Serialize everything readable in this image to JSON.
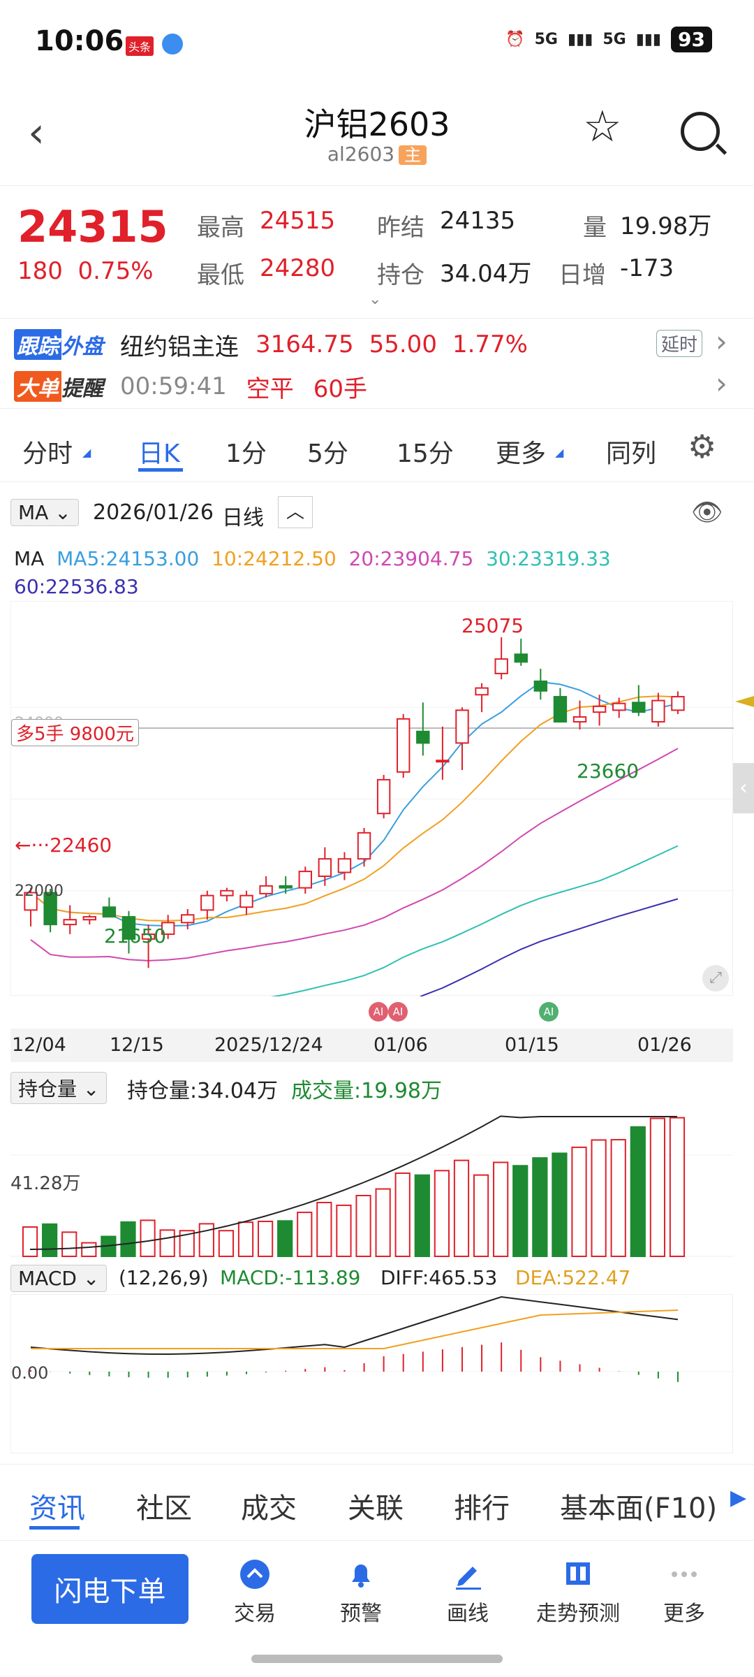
{
  "status": {
    "time": "10:06",
    "badge": "头条",
    "net1": "5G",
    "net2": "5G",
    "battery": "93"
  },
  "header": {
    "title": "沪铝2603",
    "code": "al2603",
    "main_tag": "主"
  },
  "quote": {
    "price": "24315",
    "change": "180",
    "change_pct": "0.75%",
    "high_label": "最高",
    "high": "24515",
    "low_label": "最低",
    "low": "24280",
    "settle_label": "昨结",
    "settle": "24135",
    "oi_label": "持仓",
    "oi": "34.04万",
    "vol_label": "量",
    "vol": "19.98万",
    "dayinc_label": "日增",
    "dayinc": "-173"
  },
  "ext": {
    "track_tag1": "跟踪",
    "track_tag2": "外盘",
    "track_name": "纽约铝主连",
    "track_price": "3164.75",
    "track_chg": "55.00",
    "track_pct": "1.77%",
    "delay": "延时",
    "big_tag1": "大单",
    "big_tag2": "提醒",
    "big_time": "00:59:41",
    "big_action": "空平",
    "big_qty": "60手"
  },
  "tabs": [
    {
      "label": "分时"
    },
    {
      "label": "日K"
    },
    {
      "label": "1分"
    },
    {
      "label": "5分"
    },
    {
      "label": "15分"
    },
    {
      "label": "更多"
    },
    {
      "label": "同列"
    }
  ],
  "chart_bar": {
    "indicator": "MA",
    "date": "2026/01/26",
    "period": "日线"
  },
  "ma": {
    "label": "MA",
    "ma5": "MA5:24153.00",
    "ma10": "10:24212.50",
    "ma20": "20:23904.75",
    "ma30": "30:23319.33",
    "ma60": "60:22536.83"
  },
  "main_chart": {
    "high_label": "25075",
    "low_label1": "21650",
    "low_label2": "23660",
    "left_label": "22460",
    "axis_top": "24000",
    "axis_bottom": "22000",
    "position_note": "多5手 9800元"
  },
  "dates": [
    "12/04",
    "12/15",
    "2025/12/24",
    "01/06",
    "01/15",
    "01/26"
  ],
  "ai_badges": [
    "AI",
    "AI",
    "AI"
  ],
  "oi_panel": {
    "selector": "持仓量",
    "oi": "持仓量:34.04万",
    "vol": "成交量:19.98万",
    "axis": "41.28万"
  },
  "macd_panel": {
    "selector": "MACD",
    "params": "(12,26,9)",
    "macd": "MACD:-113.89",
    "diff": "DIFF:465.53",
    "dea": "DEA:522.47",
    "axis": "0.00"
  },
  "subnav": [
    {
      "label": "资讯"
    },
    {
      "label": "社区"
    },
    {
      "label": "成交"
    },
    {
      "label": "关联"
    },
    {
      "label": "排行"
    },
    {
      "label": "基本面(F10)"
    }
  ],
  "bottom": {
    "flash": "闪电下单",
    "items": [
      {
        "label": "交易"
      },
      {
        "label": "预警"
      },
      {
        "label": "画线"
      },
      {
        "label": "走势预测"
      },
      {
        "label": "更多"
      }
    ]
  },
  "colors": {
    "up": "#e0202a",
    "down": "#1e8a32",
    "accent": "#2b6be6",
    "ma5": "#3a9ee0",
    "ma10": "#f0a020",
    "ma20": "#d048b0",
    "ma30": "#30c0b0",
    "ma60": "#3a30b0"
  },
  "chart_data": {
    "type": "candlestick",
    "candles": [
      {
        "o": 22250,
        "h": 22480,
        "l": 22080,
        "c": 22430
      },
      {
        "o": 22430,
        "h": 22470,
        "l": 22020,
        "c": 22100
      },
      {
        "o": 22100,
        "h": 22300,
        "l": 22000,
        "c": 22150
      },
      {
        "o": 22150,
        "h": 22200,
        "l": 22100,
        "c": 22180
      },
      {
        "o": 22280,
        "h": 22380,
        "l": 22180,
        "c": 22180
      },
      {
        "o": 22180,
        "h": 22240,
        "l": 21800,
        "c": 21950
      },
      {
        "o": 21950,
        "h": 22100,
        "l": 21650,
        "c": 22000
      },
      {
        "o": 22000,
        "h": 22200,
        "l": 21950,
        "c": 22120
      },
      {
        "o": 22120,
        "h": 22260,
        "l": 22050,
        "c": 22200
      },
      {
        "o": 22250,
        "h": 22450,
        "l": 22150,
        "c": 22400
      },
      {
        "o": 22400,
        "h": 22480,
        "l": 22340,
        "c": 22450
      },
      {
        "o": 22280,
        "h": 22450,
        "l": 22200,
        "c": 22400
      },
      {
        "o": 22420,
        "h": 22600,
        "l": 22380,
        "c": 22500
      },
      {
        "o": 22500,
        "h": 22600,
        "l": 22420,
        "c": 22480
      },
      {
        "o": 22480,
        "h": 22700,
        "l": 22420,
        "c": 22650
      },
      {
        "o": 22600,
        "h": 22900,
        "l": 22500,
        "c": 22780
      },
      {
        "o": 22640,
        "h": 22850,
        "l": 22560,
        "c": 22780
      },
      {
        "o": 22780,
        "h": 23100,
        "l": 22700,
        "c": 23050
      },
      {
        "o": 23250,
        "h": 23650,
        "l": 23200,
        "c": 23600
      },
      {
        "o": 23680,
        "h": 24280,
        "l": 23620,
        "c": 24230
      },
      {
        "o": 24100,
        "h": 24400,
        "l": 23850,
        "c": 23980
      },
      {
        "o": 23800,
        "h": 24150,
        "l": 23600,
        "c": 23800
      },
      {
        "o": 23980,
        "h": 24350,
        "l": 23700,
        "c": 24320
      },
      {
        "o": 24480,
        "h": 24600,
        "l": 24300,
        "c": 24550
      },
      {
        "o": 24700,
        "h": 25075,
        "l": 24640,
        "c": 24850
      },
      {
        "o": 24900,
        "h": 25060,
        "l": 24780,
        "c": 24820
      },
      {
        "o": 24620,
        "h": 24750,
        "l": 24430,
        "c": 24520
      },
      {
        "o": 24460,
        "h": 24550,
        "l": 24250,
        "c": 24200
      },
      {
        "o": 24200,
        "h": 24420,
        "l": 24120,
        "c": 24250
      },
      {
        "o": 24300,
        "h": 24480,
        "l": 24160,
        "c": 24360
      },
      {
        "o": 24320,
        "h": 24450,
        "l": 24240,
        "c": 24390
      },
      {
        "o": 24400,
        "h": 24580,
        "l": 24260,
        "c": 24300
      },
      {
        "o": 24200,
        "h": 24500,
        "l": 24150,
        "c": 24420
      },
      {
        "o": 24320,
        "h": 24515,
        "l": 24280,
        "c": 24460
      }
    ],
    "ylim": [
      21500,
      25300
    ]
  }
}
